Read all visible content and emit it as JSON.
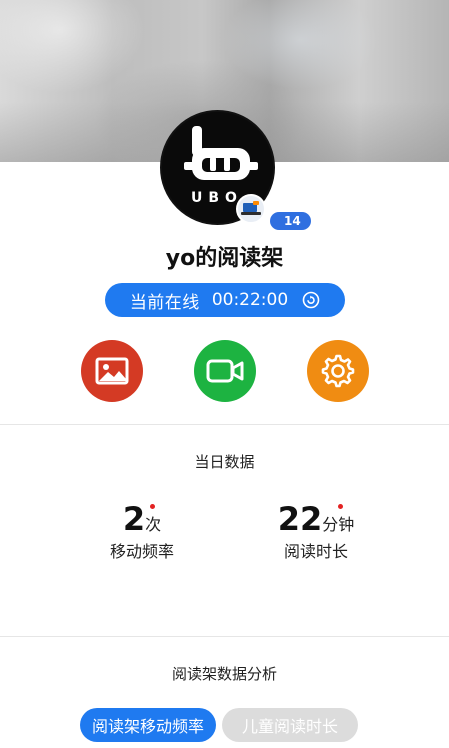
{
  "profile": {
    "avatar_text": "UBO",
    "level": "14",
    "name": "yo的阅读架"
  },
  "status": {
    "label": "当前在线",
    "time": "00:22:00"
  },
  "actions": [
    {
      "name": "gallery",
      "icon": "image-icon",
      "color": "#d43a24"
    },
    {
      "name": "video",
      "icon": "video-camera-icon",
      "color": "#1db341"
    },
    {
      "name": "settings",
      "icon": "gear-icon",
      "color": "#f08c12"
    }
  ],
  "daily": {
    "title": "当日数据",
    "stats": [
      {
        "value": "2",
        "unit": "次",
        "label": "移动频率"
      },
      {
        "value": "22",
        "unit": "分钟",
        "label": "阅读时长"
      }
    ]
  },
  "analysis": {
    "title": "阅读架数据分析",
    "tabs": [
      {
        "label": "阅读架移动频率",
        "active": true
      },
      {
        "label": "儿童阅读时长",
        "active": false
      }
    ]
  },
  "colors": {
    "accent_blue": "#1f7af0",
    "red": "#d43a24",
    "green": "#1db341",
    "orange": "#f08c12"
  }
}
